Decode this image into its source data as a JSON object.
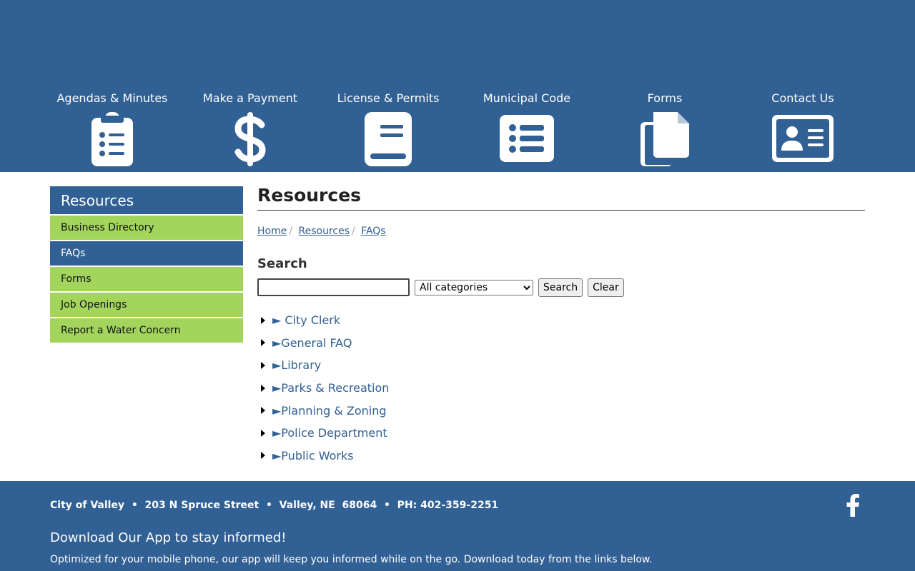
{
  "colors": {
    "brand_blue": "#316094",
    "accent_green": "#a3d55d"
  },
  "quick_links": [
    {
      "label": "Agendas & Minutes",
      "icon": "clipboard-list-icon"
    },
    {
      "label": "Make a Payment",
      "icon": "dollar-sign-icon"
    },
    {
      "label": "License & Permits",
      "icon": "book-icon"
    },
    {
      "label": "Municipal Code",
      "icon": "list-icon"
    },
    {
      "label": "Forms",
      "icon": "copy-icon"
    },
    {
      "label": "Contact Us",
      "icon": "address-card-icon"
    }
  ],
  "sidebar": {
    "title": "Resources",
    "items": [
      {
        "label": "Business Directory",
        "active": false
      },
      {
        "label": "FAQs",
        "active": true
      },
      {
        "label": "Forms",
        "active": false
      },
      {
        "label": "Job Openings",
        "active": false
      },
      {
        "label": "Report a Water Concern",
        "active": false
      }
    ]
  },
  "main": {
    "title": "Resources",
    "breadcrumb": [
      "Home",
      "Resources",
      "FAQs"
    ],
    "search": {
      "heading": "Search",
      "input_value": "",
      "category_selected": "All categories",
      "search_button": "Search",
      "clear_button": "Clear"
    },
    "faq_categories": [
      "► City Clerk",
      "►General FAQ",
      "►Library",
      "►Parks & Recreation",
      "►Planning & Zoning",
      "►Police Department",
      "►Public Works"
    ]
  },
  "footer": {
    "address": "City of Valley  •  203 N Spruce Street  •  Valley, NE  68064  •  PH: 402-359-2251",
    "social_icon": "facebook-icon",
    "app_heading": "Download Our App to stay informed!",
    "app_text": "Optimized for your mobile phone, our app will keep you informed while on the go. Download today from the links below."
  }
}
